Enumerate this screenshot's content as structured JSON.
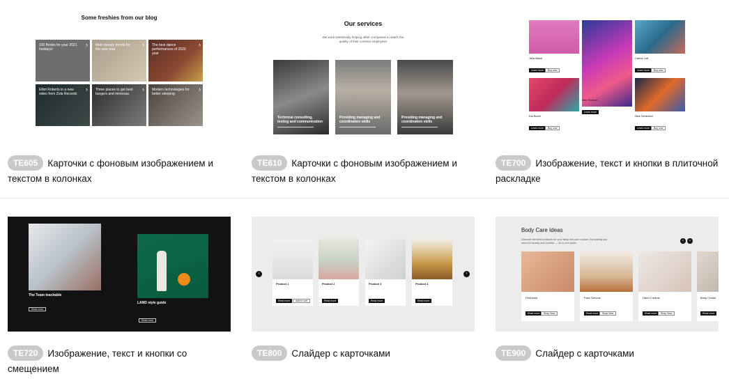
{
  "cards": [
    {
      "code": "TE605",
      "title": "Карточки с фоновым изображением и текстом в колонках",
      "preview": {
        "heading": "Some freshies from our blog",
        "tiles": [
          "100 Books for your 2021 holidays!",
          "Main beauty trends for the new year",
          "The best dance performances of 2020 year",
          "Elliot Roberts in a new video from Zola Records",
          "Three places to get best burgers and mimosas",
          "Modern technologies for better sleeping"
        ]
      }
    },
    {
      "code": "TE610",
      "title": "Карточки с фоновым изображением и текстом в колонках",
      "preview": {
        "heading": "Our services",
        "subtitle": "We work extensively helping other companies to watch the quality of their contract employees",
        "tiles": [
          "Technical consulting, testing and communication",
          "Providing managing and coordination skills",
          "Providing managing and coordination skills"
        ]
      }
    },
    {
      "code": "TE700",
      "title": "Изображение, текст и кнопки в плиточной раскладке",
      "preview": {
        "names": [
          "Julia Black",
          "Carlos Lott",
          "Max Horizon",
          "Kai Burch",
          "Nick Schembri"
        ],
        "learn_more": "Learn more",
        "buy_now": "Buy now"
      }
    },
    {
      "code": "TE720",
      "title": "Изображение, текст и кнопки со смещением",
      "preview": {
        "left_title": "The Team teachable",
        "right_title": "LAND style guide",
        "button": "Read more"
      }
    },
    {
      "code": "TE800",
      "title": "Слайдер с карточками",
      "preview": {
        "products": [
          "Product 1",
          "Product 2",
          "Product 3",
          "Product 4"
        ],
        "read_more": "Read more",
        "add_cart": "Add to cart"
      }
    },
    {
      "code": "TE900",
      "title": "Слайдер с карточками",
      "preview": {
        "heading": "Body Care Ideas",
        "subtitle": "Discover the best products for your daily self-care routine. Everything you need for beauty and comfort — all in one place.",
        "products": [
          "Perfumes",
          "Face Serums",
          "Hand Creams",
          "Body Cream"
        ],
        "read_more": "Read more",
        "shop_now": "Shop Now"
      }
    }
  ]
}
